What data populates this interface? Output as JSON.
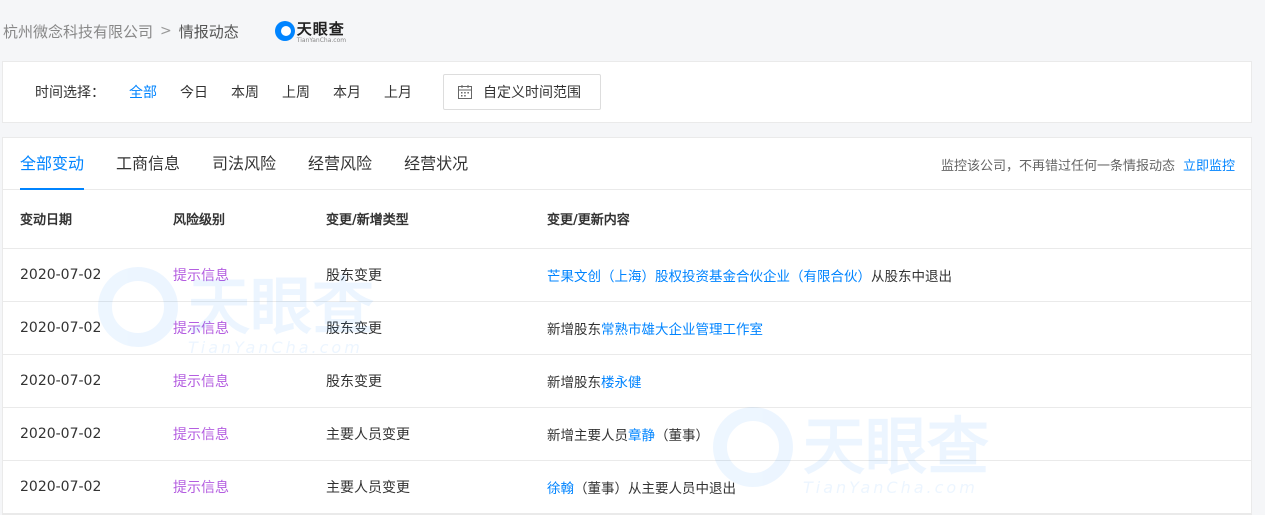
{
  "breadcrumb": {
    "company": "杭州微念科技有限公司",
    "separator": ">",
    "page": "情报动态"
  },
  "logo": {
    "text": "天眼查",
    "sub": "TianYanCha.com"
  },
  "filter": {
    "label": "时间选择：",
    "options": [
      "全部",
      "今日",
      "本周",
      "上周",
      "本月",
      "上月"
    ],
    "active": "全部",
    "custom_range": "自定义时间范围"
  },
  "tabs": {
    "items": [
      "全部变动",
      "工商信息",
      "司法风险",
      "经营风险",
      "经营状况"
    ],
    "active": "全部变动"
  },
  "monitor": {
    "text": "监控该公司，不再错过任何一条情报动态",
    "link": "立即监控"
  },
  "table": {
    "headers": [
      "变动日期",
      "风险级别",
      "变更/新增类型",
      "变更/更新内容"
    ],
    "rows": [
      {
        "date": "2020-07-02",
        "level": "提示信息",
        "type": "股东变更",
        "parts": [
          {
            "t": "芒果文创（上海）股权投资基金合伙企业（有限合伙）",
            "link": true
          },
          {
            "t": "从股东中退出",
            "link": false
          }
        ]
      },
      {
        "date": "2020-07-02",
        "level": "提示信息",
        "type": "股东变更",
        "parts": [
          {
            "t": "新增股东",
            "link": false
          },
          {
            "t": "常熟市雄大企业管理工作室",
            "link": true
          }
        ]
      },
      {
        "date": "2020-07-02",
        "level": "提示信息",
        "type": "股东变更",
        "parts": [
          {
            "t": "新增股东",
            "link": false
          },
          {
            "t": "楼永健",
            "link": true
          }
        ]
      },
      {
        "date": "2020-07-02",
        "level": "提示信息",
        "type": "主要人员变更",
        "parts": [
          {
            "t": "新增主要人员",
            "link": false
          },
          {
            "t": "章静",
            "link": true
          },
          {
            "t": "（董事）",
            "link": false
          }
        ]
      },
      {
        "date": "2020-07-02",
        "level": "提示信息",
        "type": "主要人员变更",
        "parts": [
          {
            "t": "徐翰",
            "link": true
          },
          {
            "t": "（董事）从主要人员中退出",
            "link": false
          }
        ]
      }
    ]
  },
  "colors": {
    "accent": "#0084ff",
    "level": "#b45ee0"
  }
}
